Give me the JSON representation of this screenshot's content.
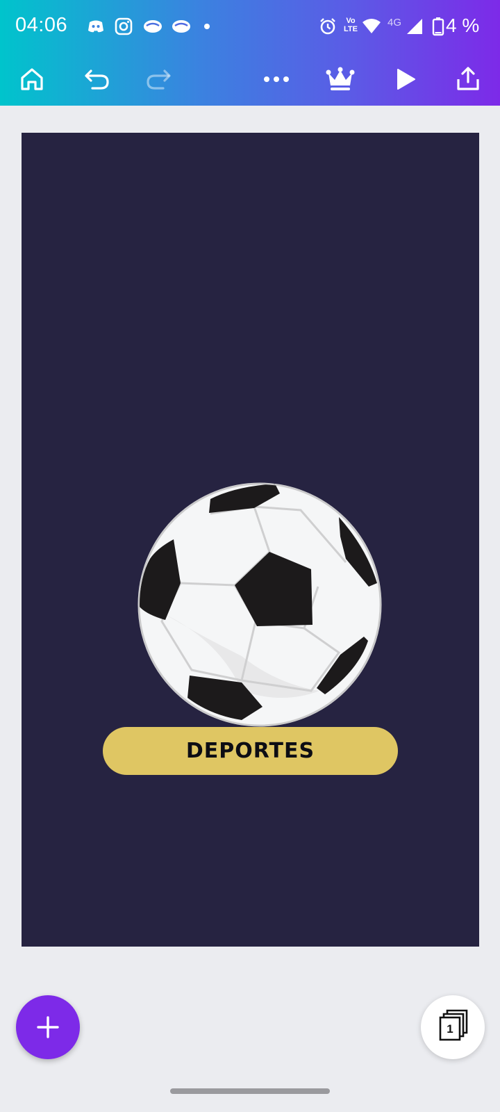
{
  "status_bar": {
    "time": "04:06",
    "network_label": "4G",
    "volte_label_top": "Vo",
    "volte_label_bottom": "LTE",
    "battery_percent": "4 %"
  },
  "toolbar": {
    "icons": [
      "home-icon",
      "undo-icon",
      "redo-icon",
      "more-icon",
      "crown-icon",
      "play-icon",
      "share-icon"
    ]
  },
  "design": {
    "label": "DEPORTES",
    "colors": {
      "background": "#262341",
      "pill": "#dfc663",
      "text": "#0d0d14"
    }
  },
  "pages": {
    "count": "1"
  },
  "colors": {
    "accent": "#7d2ae8",
    "gradient_start": "#00c4cc",
    "gradient_end": "#7d2ae8"
  }
}
